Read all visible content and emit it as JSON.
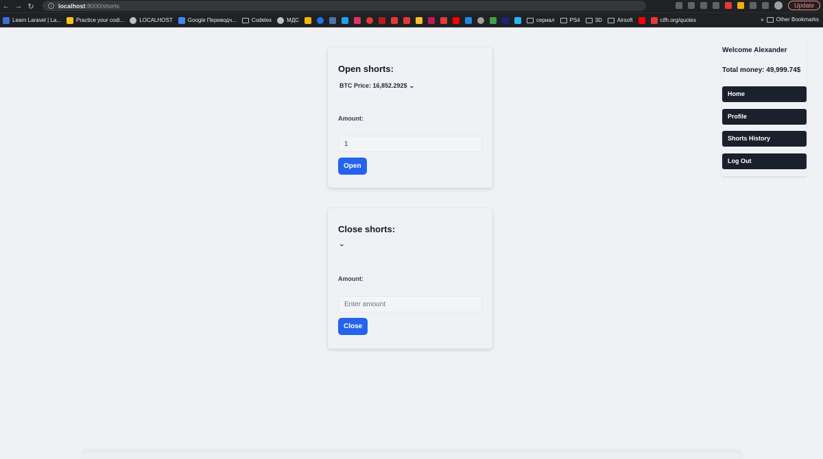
{
  "browser": {
    "url_host": "localhost",
    "url_path": ":8000/shorts",
    "update_label": "Update",
    "bookmarks": [
      {
        "label": "Learn Laravel | La...",
        "icon": "laravel-icon",
        "color": "#3c6fd9"
      },
      {
        "label": "Practice your codi...",
        "icon": "codewars-icon",
        "color": "#f5c518"
      },
      {
        "label": "LOCALHOST",
        "icon": "globe-icon",
        "color": "#bdc1c6"
      },
      {
        "label": "Google Переводч...",
        "icon": "google-translate-icon",
        "color": "#4285f4"
      },
      {
        "label": "Codelex",
        "icon": "folder-icon",
        "color": ""
      },
      {
        "label": "МДС",
        "icon": "globe-icon",
        "color": "#bdc1c6"
      }
    ],
    "bookmarks_2": [
      {
        "label": "сериал",
        "icon": "folder-icon"
      },
      {
        "label": "PS4",
        "icon": "folder-icon"
      },
      {
        "label": "3D",
        "icon": "folder-icon"
      },
      {
        "label": "Airsoft",
        "icon": "folder-icon"
      },
      {
        "label": "cifh.org/quotes",
        "icon": "cifh-icon"
      }
    ],
    "other_bookmarks": "Other Bookmarks"
  },
  "open_card": {
    "title": "Open shorts:",
    "select_value": "BTC Price: 16,852.292$",
    "amount_label": "Amount:",
    "amount_value": "1",
    "button_label": "Open"
  },
  "close_card": {
    "title": "Close shorts:",
    "amount_label": "Amount:",
    "amount_placeholder": "Enter amount",
    "button_label": "Close"
  },
  "sidebar": {
    "welcome": "Welcome Alexander",
    "total_money": "Total money: 49,999.74$",
    "items": [
      {
        "label": "Home"
      },
      {
        "label": "Profile"
      },
      {
        "label": "Shorts History"
      },
      {
        "label": "Log Out"
      }
    ]
  },
  "colors": {
    "accent": "#2563eb",
    "nav_button": "#1a202c",
    "background": "#f0f1f5"
  }
}
